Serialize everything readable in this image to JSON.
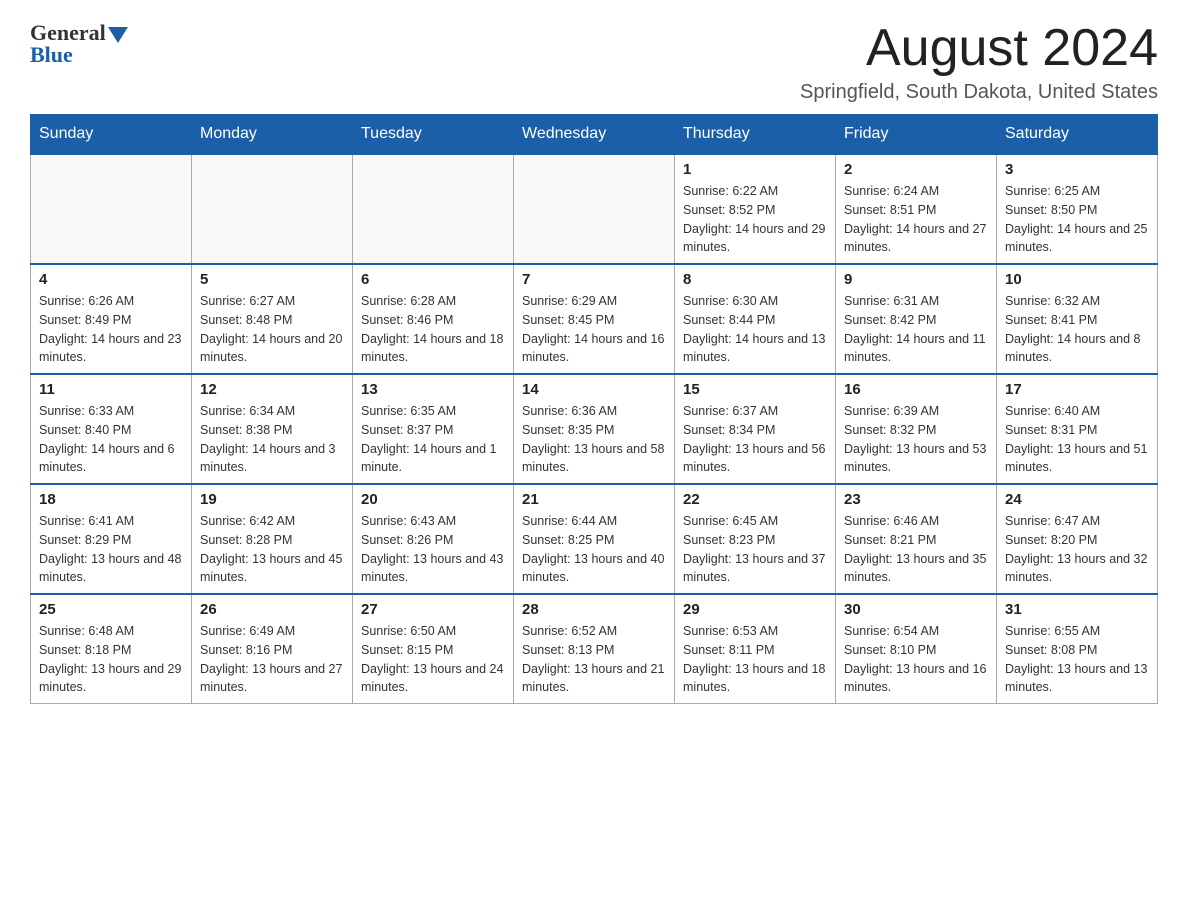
{
  "header": {
    "logo_general": "General",
    "logo_blue": "Blue",
    "month_title": "August 2024",
    "location": "Springfield, South Dakota, United States"
  },
  "weekdays": [
    "Sunday",
    "Monday",
    "Tuesday",
    "Wednesday",
    "Thursday",
    "Friday",
    "Saturday"
  ],
  "weeks": [
    [
      {
        "day": "",
        "info": ""
      },
      {
        "day": "",
        "info": ""
      },
      {
        "day": "",
        "info": ""
      },
      {
        "day": "",
        "info": ""
      },
      {
        "day": "1",
        "info": "Sunrise: 6:22 AM\nSunset: 8:52 PM\nDaylight: 14 hours and 29 minutes."
      },
      {
        "day": "2",
        "info": "Sunrise: 6:24 AM\nSunset: 8:51 PM\nDaylight: 14 hours and 27 minutes."
      },
      {
        "day": "3",
        "info": "Sunrise: 6:25 AM\nSunset: 8:50 PM\nDaylight: 14 hours and 25 minutes."
      }
    ],
    [
      {
        "day": "4",
        "info": "Sunrise: 6:26 AM\nSunset: 8:49 PM\nDaylight: 14 hours and 23 minutes."
      },
      {
        "day": "5",
        "info": "Sunrise: 6:27 AM\nSunset: 8:48 PM\nDaylight: 14 hours and 20 minutes."
      },
      {
        "day": "6",
        "info": "Sunrise: 6:28 AM\nSunset: 8:46 PM\nDaylight: 14 hours and 18 minutes."
      },
      {
        "day": "7",
        "info": "Sunrise: 6:29 AM\nSunset: 8:45 PM\nDaylight: 14 hours and 16 minutes."
      },
      {
        "day": "8",
        "info": "Sunrise: 6:30 AM\nSunset: 8:44 PM\nDaylight: 14 hours and 13 minutes."
      },
      {
        "day": "9",
        "info": "Sunrise: 6:31 AM\nSunset: 8:42 PM\nDaylight: 14 hours and 11 minutes."
      },
      {
        "day": "10",
        "info": "Sunrise: 6:32 AM\nSunset: 8:41 PM\nDaylight: 14 hours and 8 minutes."
      }
    ],
    [
      {
        "day": "11",
        "info": "Sunrise: 6:33 AM\nSunset: 8:40 PM\nDaylight: 14 hours and 6 minutes."
      },
      {
        "day": "12",
        "info": "Sunrise: 6:34 AM\nSunset: 8:38 PM\nDaylight: 14 hours and 3 minutes."
      },
      {
        "day": "13",
        "info": "Sunrise: 6:35 AM\nSunset: 8:37 PM\nDaylight: 14 hours and 1 minute."
      },
      {
        "day": "14",
        "info": "Sunrise: 6:36 AM\nSunset: 8:35 PM\nDaylight: 13 hours and 58 minutes."
      },
      {
        "day": "15",
        "info": "Sunrise: 6:37 AM\nSunset: 8:34 PM\nDaylight: 13 hours and 56 minutes."
      },
      {
        "day": "16",
        "info": "Sunrise: 6:39 AM\nSunset: 8:32 PM\nDaylight: 13 hours and 53 minutes."
      },
      {
        "day": "17",
        "info": "Sunrise: 6:40 AM\nSunset: 8:31 PM\nDaylight: 13 hours and 51 minutes."
      }
    ],
    [
      {
        "day": "18",
        "info": "Sunrise: 6:41 AM\nSunset: 8:29 PM\nDaylight: 13 hours and 48 minutes."
      },
      {
        "day": "19",
        "info": "Sunrise: 6:42 AM\nSunset: 8:28 PM\nDaylight: 13 hours and 45 minutes."
      },
      {
        "day": "20",
        "info": "Sunrise: 6:43 AM\nSunset: 8:26 PM\nDaylight: 13 hours and 43 minutes."
      },
      {
        "day": "21",
        "info": "Sunrise: 6:44 AM\nSunset: 8:25 PM\nDaylight: 13 hours and 40 minutes."
      },
      {
        "day": "22",
        "info": "Sunrise: 6:45 AM\nSunset: 8:23 PM\nDaylight: 13 hours and 37 minutes."
      },
      {
        "day": "23",
        "info": "Sunrise: 6:46 AM\nSunset: 8:21 PM\nDaylight: 13 hours and 35 minutes."
      },
      {
        "day": "24",
        "info": "Sunrise: 6:47 AM\nSunset: 8:20 PM\nDaylight: 13 hours and 32 minutes."
      }
    ],
    [
      {
        "day": "25",
        "info": "Sunrise: 6:48 AM\nSunset: 8:18 PM\nDaylight: 13 hours and 29 minutes."
      },
      {
        "day": "26",
        "info": "Sunrise: 6:49 AM\nSunset: 8:16 PM\nDaylight: 13 hours and 27 minutes."
      },
      {
        "day": "27",
        "info": "Sunrise: 6:50 AM\nSunset: 8:15 PM\nDaylight: 13 hours and 24 minutes."
      },
      {
        "day": "28",
        "info": "Sunrise: 6:52 AM\nSunset: 8:13 PM\nDaylight: 13 hours and 21 minutes."
      },
      {
        "day": "29",
        "info": "Sunrise: 6:53 AM\nSunset: 8:11 PM\nDaylight: 13 hours and 18 minutes."
      },
      {
        "day": "30",
        "info": "Sunrise: 6:54 AM\nSunset: 8:10 PM\nDaylight: 13 hours and 16 minutes."
      },
      {
        "day": "31",
        "info": "Sunrise: 6:55 AM\nSunset: 8:08 PM\nDaylight: 13 hours and 13 minutes."
      }
    ]
  ]
}
